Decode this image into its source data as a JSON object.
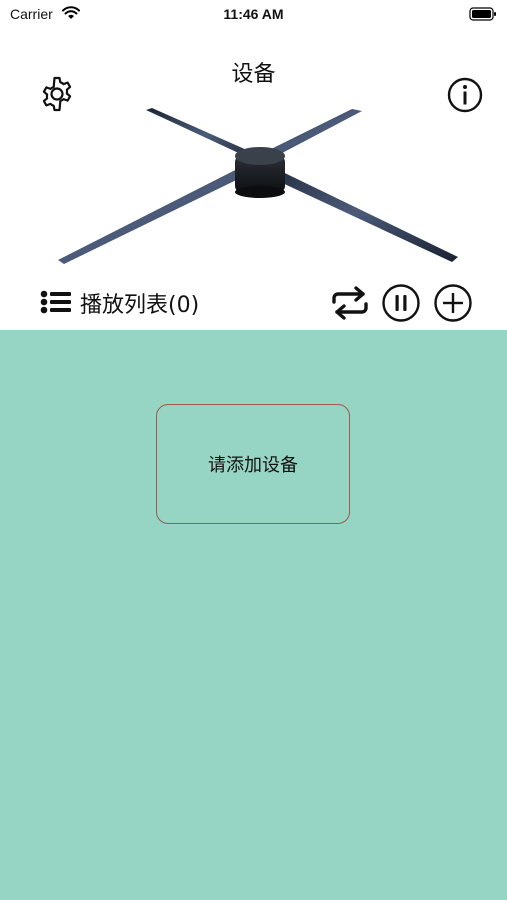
{
  "status_bar": {
    "carrier": "Carrier",
    "time": "11:46 AM"
  },
  "header": {
    "title": "设备",
    "settings_icon": "gear-icon",
    "info_icon": "info-circle-icon"
  },
  "device_image": {
    "description_icon": "hologram-fan-image"
  },
  "playlist": {
    "label": "播放列表(0)",
    "list_icon": "list-icon",
    "repeat_icon": "repeat-icon",
    "pause_icon": "pause-circle-icon",
    "add_icon": "add-circle-icon"
  },
  "content": {
    "background": "#96d5c4",
    "add_device_label": "请添加设备",
    "card_border": "#9b5a4b"
  }
}
